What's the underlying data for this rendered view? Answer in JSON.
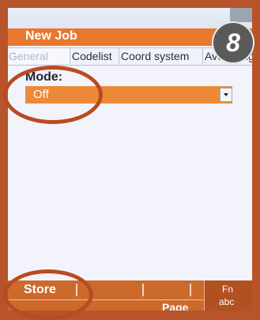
{
  "title": "New Job",
  "tabs": [
    "General",
    "Codelist",
    "Coord system",
    "Averaging"
  ],
  "mode": {
    "label": "Mode:",
    "value": "Off"
  },
  "softkeys": {
    "store": "Store",
    "page": "Page",
    "fn": "Fn",
    "abc": "abc"
  },
  "step_badge": "8",
  "colors": {
    "accent": "#e8782e",
    "highlight": "#b94b22"
  }
}
